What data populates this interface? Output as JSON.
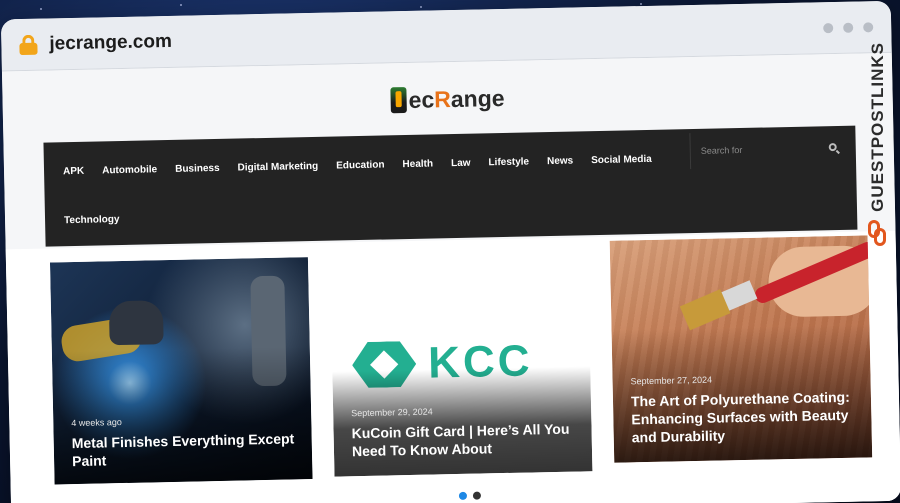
{
  "browser": {
    "url": "jecrange.com"
  },
  "site": {
    "logo_left": "ec ",
    "logo_accent": "R",
    "logo_right": "ange",
    "accent_color": "#e8731a"
  },
  "nav": {
    "items": [
      {
        "label": "APK"
      },
      {
        "label": "Automobile"
      },
      {
        "label": "Business"
      },
      {
        "label": "Digital Marketing"
      },
      {
        "label": "Education"
      },
      {
        "label": "Health"
      },
      {
        "label": "Law"
      },
      {
        "label": "Lifestyle"
      },
      {
        "label": "News"
      },
      {
        "label": "Social Media"
      },
      {
        "label": "Technology"
      }
    ],
    "search_placeholder": "Search for"
  },
  "slider": {
    "cards": [
      {
        "meta": "4 weeks ago",
        "title": "Metal Finishes Everything Except Paint"
      },
      {
        "meta": "September 29, 2024",
        "title": "KuCoin Gift Card | Here’s All You Need To Know About",
        "image_text": "KCC"
      },
      {
        "meta": "September 27, 2024",
        "title": "The Art of Polyurethane Coating: Enhancing Surfaces with Beauty and Durability"
      }
    ],
    "active_dot": 1,
    "dot_count": 2
  },
  "badge": {
    "text": "GUESTPOSTLINKS",
    "color": "#e2571e"
  }
}
